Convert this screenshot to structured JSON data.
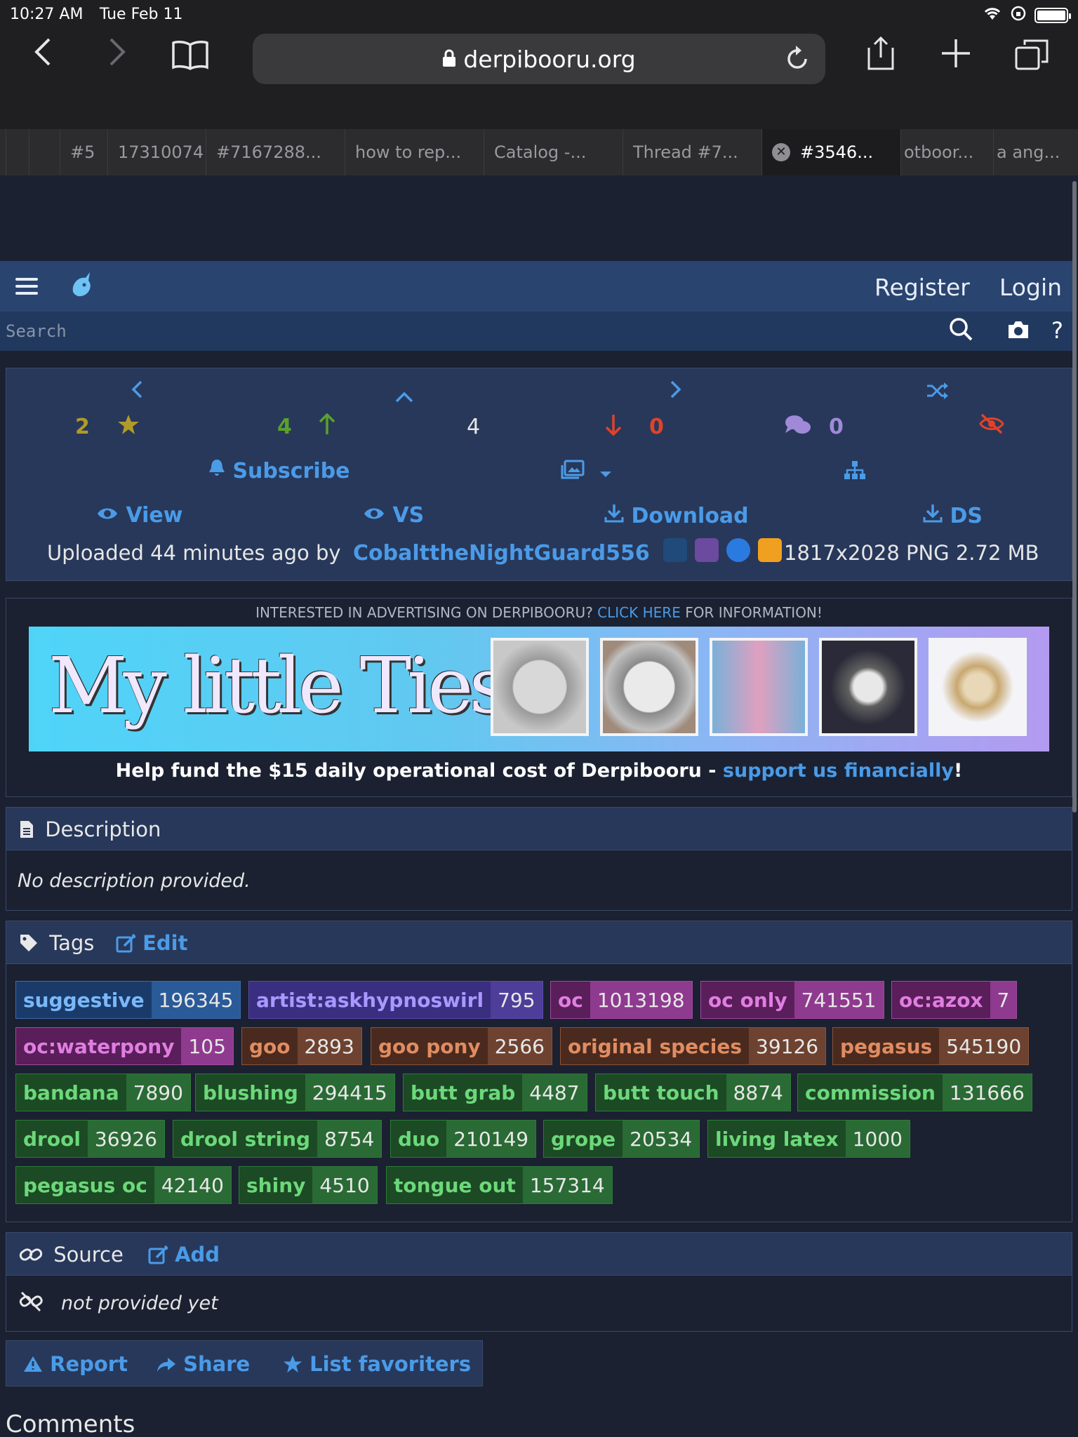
{
  "status_bar": {
    "time": "10:27 AM",
    "date": "Tue Feb 11"
  },
  "browser": {
    "url": "derpibooru.org",
    "tabs": [
      "#5",
      "17310074",
      "#7167288...",
      "how to rep...",
      "Catalog -...",
      "Thread #7...",
      "#3546...",
      "otboor...",
      "a ang..."
    ],
    "active_tab": 6
  },
  "site": {
    "register": "Register",
    "login": "Login",
    "search_placeholder": "Search",
    "help": "?"
  },
  "image_bar": {
    "faves": "2",
    "upvotes": "4",
    "score": "4",
    "downvotes": "0",
    "comments": "0",
    "subscribe": "Subscribe",
    "view": "View",
    "vs": "VS",
    "download": "Download",
    "ds": "DS",
    "uploaded_text": "Uploaded 44 minutes ago by",
    "uploader": "CobalttheNightGuard556",
    "file_info": "1817x2028 PNG 2.72 MB"
  },
  "ad": {
    "note_prefix": "INTERESTED IN ADVERTISING ON DERPIBOORU?",
    "note_link": "CLICK HERE",
    "note_suffix": "FOR INFORMATION!",
    "banner_title": "My little Ties",
    "help_prefix": "Help fund the $15 daily operational cost of Derpibooru -",
    "help_link": "support us financially",
    "help_suffix": "!"
  },
  "description": {
    "title": "Description",
    "body": "No description provided."
  },
  "tags_block": {
    "title": "Tags",
    "edit": "Edit",
    "tags": [
      {
        "name": "suggestive",
        "count": "196345",
        "type": "rating"
      },
      {
        "name": "artist:askhypnoswirl",
        "count": "795",
        "type": "artist"
      },
      {
        "name": "oc",
        "count": "1013198",
        "type": "oc"
      },
      {
        "name": "oc only",
        "count": "741551",
        "type": "oc"
      },
      {
        "name": "oc:azox",
        "count": "7",
        "type": "oc"
      },
      {
        "name": "oc:waterpony",
        "count": "105",
        "type": "oc"
      },
      {
        "name": "goo",
        "count": "2893",
        "type": "species"
      },
      {
        "name": "goo pony",
        "count": "2566",
        "type": "species"
      },
      {
        "name": "original species",
        "count": "39126",
        "type": "species"
      },
      {
        "name": "pegasus",
        "count": "545190",
        "type": "species"
      },
      {
        "name": "bandana",
        "count": "7890",
        "type": "gen"
      },
      {
        "name": "blushing",
        "count": "294415",
        "type": "gen"
      },
      {
        "name": "butt grab",
        "count": "4487",
        "type": "gen"
      },
      {
        "name": "butt touch",
        "count": "8874",
        "type": "gen"
      },
      {
        "name": "commission",
        "count": "131666",
        "type": "gen"
      },
      {
        "name": "drool",
        "count": "36926",
        "type": "gen"
      },
      {
        "name": "drool string",
        "count": "8754",
        "type": "gen"
      },
      {
        "name": "duo",
        "count": "210149",
        "type": "gen"
      },
      {
        "name": "grope",
        "count": "20534",
        "type": "gen"
      },
      {
        "name": "living latex",
        "count": "1000",
        "type": "gen"
      },
      {
        "name": "pegasus oc",
        "count": "42140",
        "type": "gen"
      },
      {
        "name": "shiny",
        "count": "4510",
        "type": "gen"
      },
      {
        "name": "tongue out",
        "count": "157314",
        "type": "gen"
      }
    ]
  },
  "source": {
    "title": "Source",
    "add": "Add",
    "body": "not provided yet"
  },
  "actions": {
    "report": "Report",
    "share": "Share",
    "list_favoriters": "List favoriters"
  },
  "comments_heading": "Comments"
}
